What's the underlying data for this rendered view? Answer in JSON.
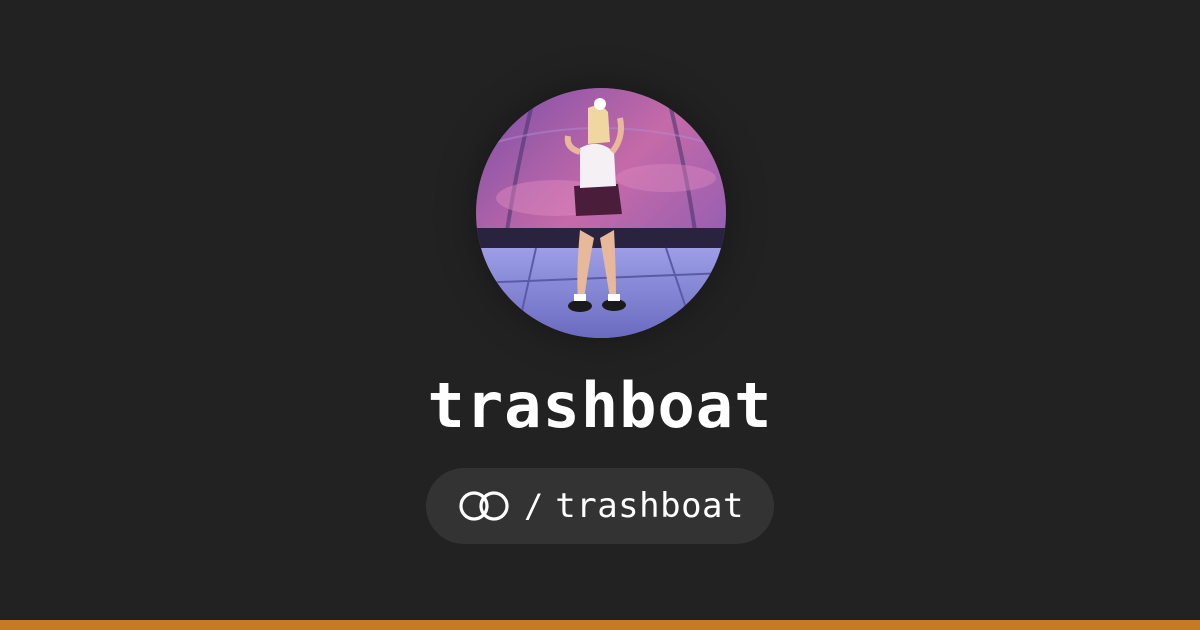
{
  "profile": {
    "display_name": "trashboat",
    "handle_separator": "/",
    "handle": "trashboat",
    "avatar_icon": "profile-photo",
    "logo_icon": "linked-rings-icon"
  },
  "colors": {
    "background": "#222222",
    "pill": "#333333",
    "text": "#ffffff",
    "accent_bar": "#c77a24"
  }
}
